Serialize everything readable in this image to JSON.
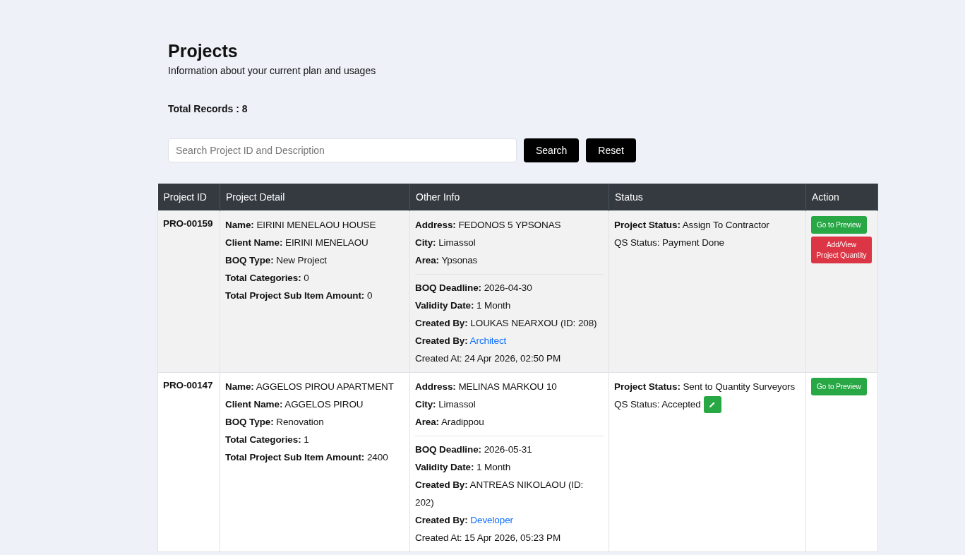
{
  "header": {
    "title": "Projects",
    "subtitle": "Information about your current plan and usages",
    "total_label": "Total Records : 8"
  },
  "search": {
    "placeholder": "Search Project ID and Description",
    "buttons": [
      "Search",
      "Reset"
    ]
  },
  "table": {
    "columns": [
      "Project ID",
      "Project Detail",
      "Other Info",
      "Status",
      "Action"
    ],
    "rows": [
      {
        "id": "PRO-00159",
        "details": [
          {
            "kind": "labeled",
            "label": "Name:",
            "value": "EIRINI MENELAOU HOUSE"
          },
          {
            "kind": "labeled",
            "label": "Client Name:",
            "value": "EIRINI MENELAOU"
          },
          {
            "kind": "labeled",
            "label": "BOQ Type:",
            "value": "New Project"
          },
          {
            "kind": "labeled",
            "label": "Total Categories:",
            "value": "0"
          },
          {
            "kind": "labeled",
            "label": "Total Project Sub Item Amount:",
            "value": "0"
          }
        ],
        "location": [
          {
            "kind": "labeled",
            "label": "Address:",
            "value": "FEDONOS 5 YPSONAS"
          },
          {
            "kind": "labeled",
            "label": "City:",
            "value": "Limassol"
          },
          {
            "kind": "labeled",
            "label": "Area:",
            "value": "Ypsonas"
          }
        ],
        "meta": [
          {
            "kind": "labeled",
            "label": "BOQ Deadline:",
            "value": "2026-04-30"
          },
          {
            "kind": "labeled",
            "label": "Validity Date:",
            "value": "1 Month"
          },
          {
            "kind": "labeled",
            "label": "Created By:",
            "value": "LOUKAS NEARXOU (ID: 208)"
          },
          {
            "kind": "link",
            "label": "Created By:",
            "value": "Architect"
          },
          {
            "kind": "plain",
            "text": "Created At: 24 Apr 2026, 02:50 PM"
          }
        ],
        "status": {
          "label": "Project Status:",
          "value": "Assign To Contractor",
          "qs": "QS Status: Payment Done",
          "editable": false
        },
        "actions": [
          {
            "label": "Go to Preview",
            "kind": "success"
          },
          {
            "label": "Add/View Project Quantity",
            "kind": "danger"
          }
        ]
      },
      {
        "id": "PRO-00147",
        "details": [
          {
            "kind": "labeled",
            "label": "Name:",
            "value": "AGGELOS PIROU APARTMENT"
          },
          {
            "kind": "labeled",
            "label": "Client Name:",
            "value": "AGGELOS PIROU"
          },
          {
            "kind": "labeled",
            "label": "BOQ Type:",
            "value": "Renovation"
          },
          {
            "kind": "labeled",
            "label": "Total Categories:",
            "value": "1"
          },
          {
            "kind": "labeled",
            "label": "Total Project Sub Item Amount:",
            "value": "2400"
          }
        ],
        "location": [
          {
            "kind": "labeled",
            "label": "Address:",
            "value": "MELINAS MARKOU 10"
          },
          {
            "kind": "labeled",
            "label": "City:",
            "value": "Limassol"
          },
          {
            "kind": "labeled",
            "label": "Area:",
            "value": "Aradippou"
          }
        ],
        "meta": [
          {
            "kind": "labeled",
            "label": "BOQ Deadline:",
            "value": "2026-05-31"
          },
          {
            "kind": "labeled",
            "label": "Validity Date:",
            "value": "1 Month"
          },
          {
            "kind": "labeled",
            "label": "Created By:",
            "value": "ANTREAS NIKOLAOU (ID: 202)"
          },
          {
            "kind": "link",
            "label": "Created By:",
            "value": "Developer"
          },
          {
            "kind": "plain",
            "text": "Created At: 15 Apr 2026, 05:23 PM"
          }
        ],
        "status": {
          "label": "Project Status:",
          "value": "Sent to Quantity Surveyors",
          "qs": "QS Status: Accepted",
          "editable": true
        },
        "actions": [
          {
            "label": "Go to Preview",
            "kind": "success"
          }
        ]
      }
    ]
  }
}
